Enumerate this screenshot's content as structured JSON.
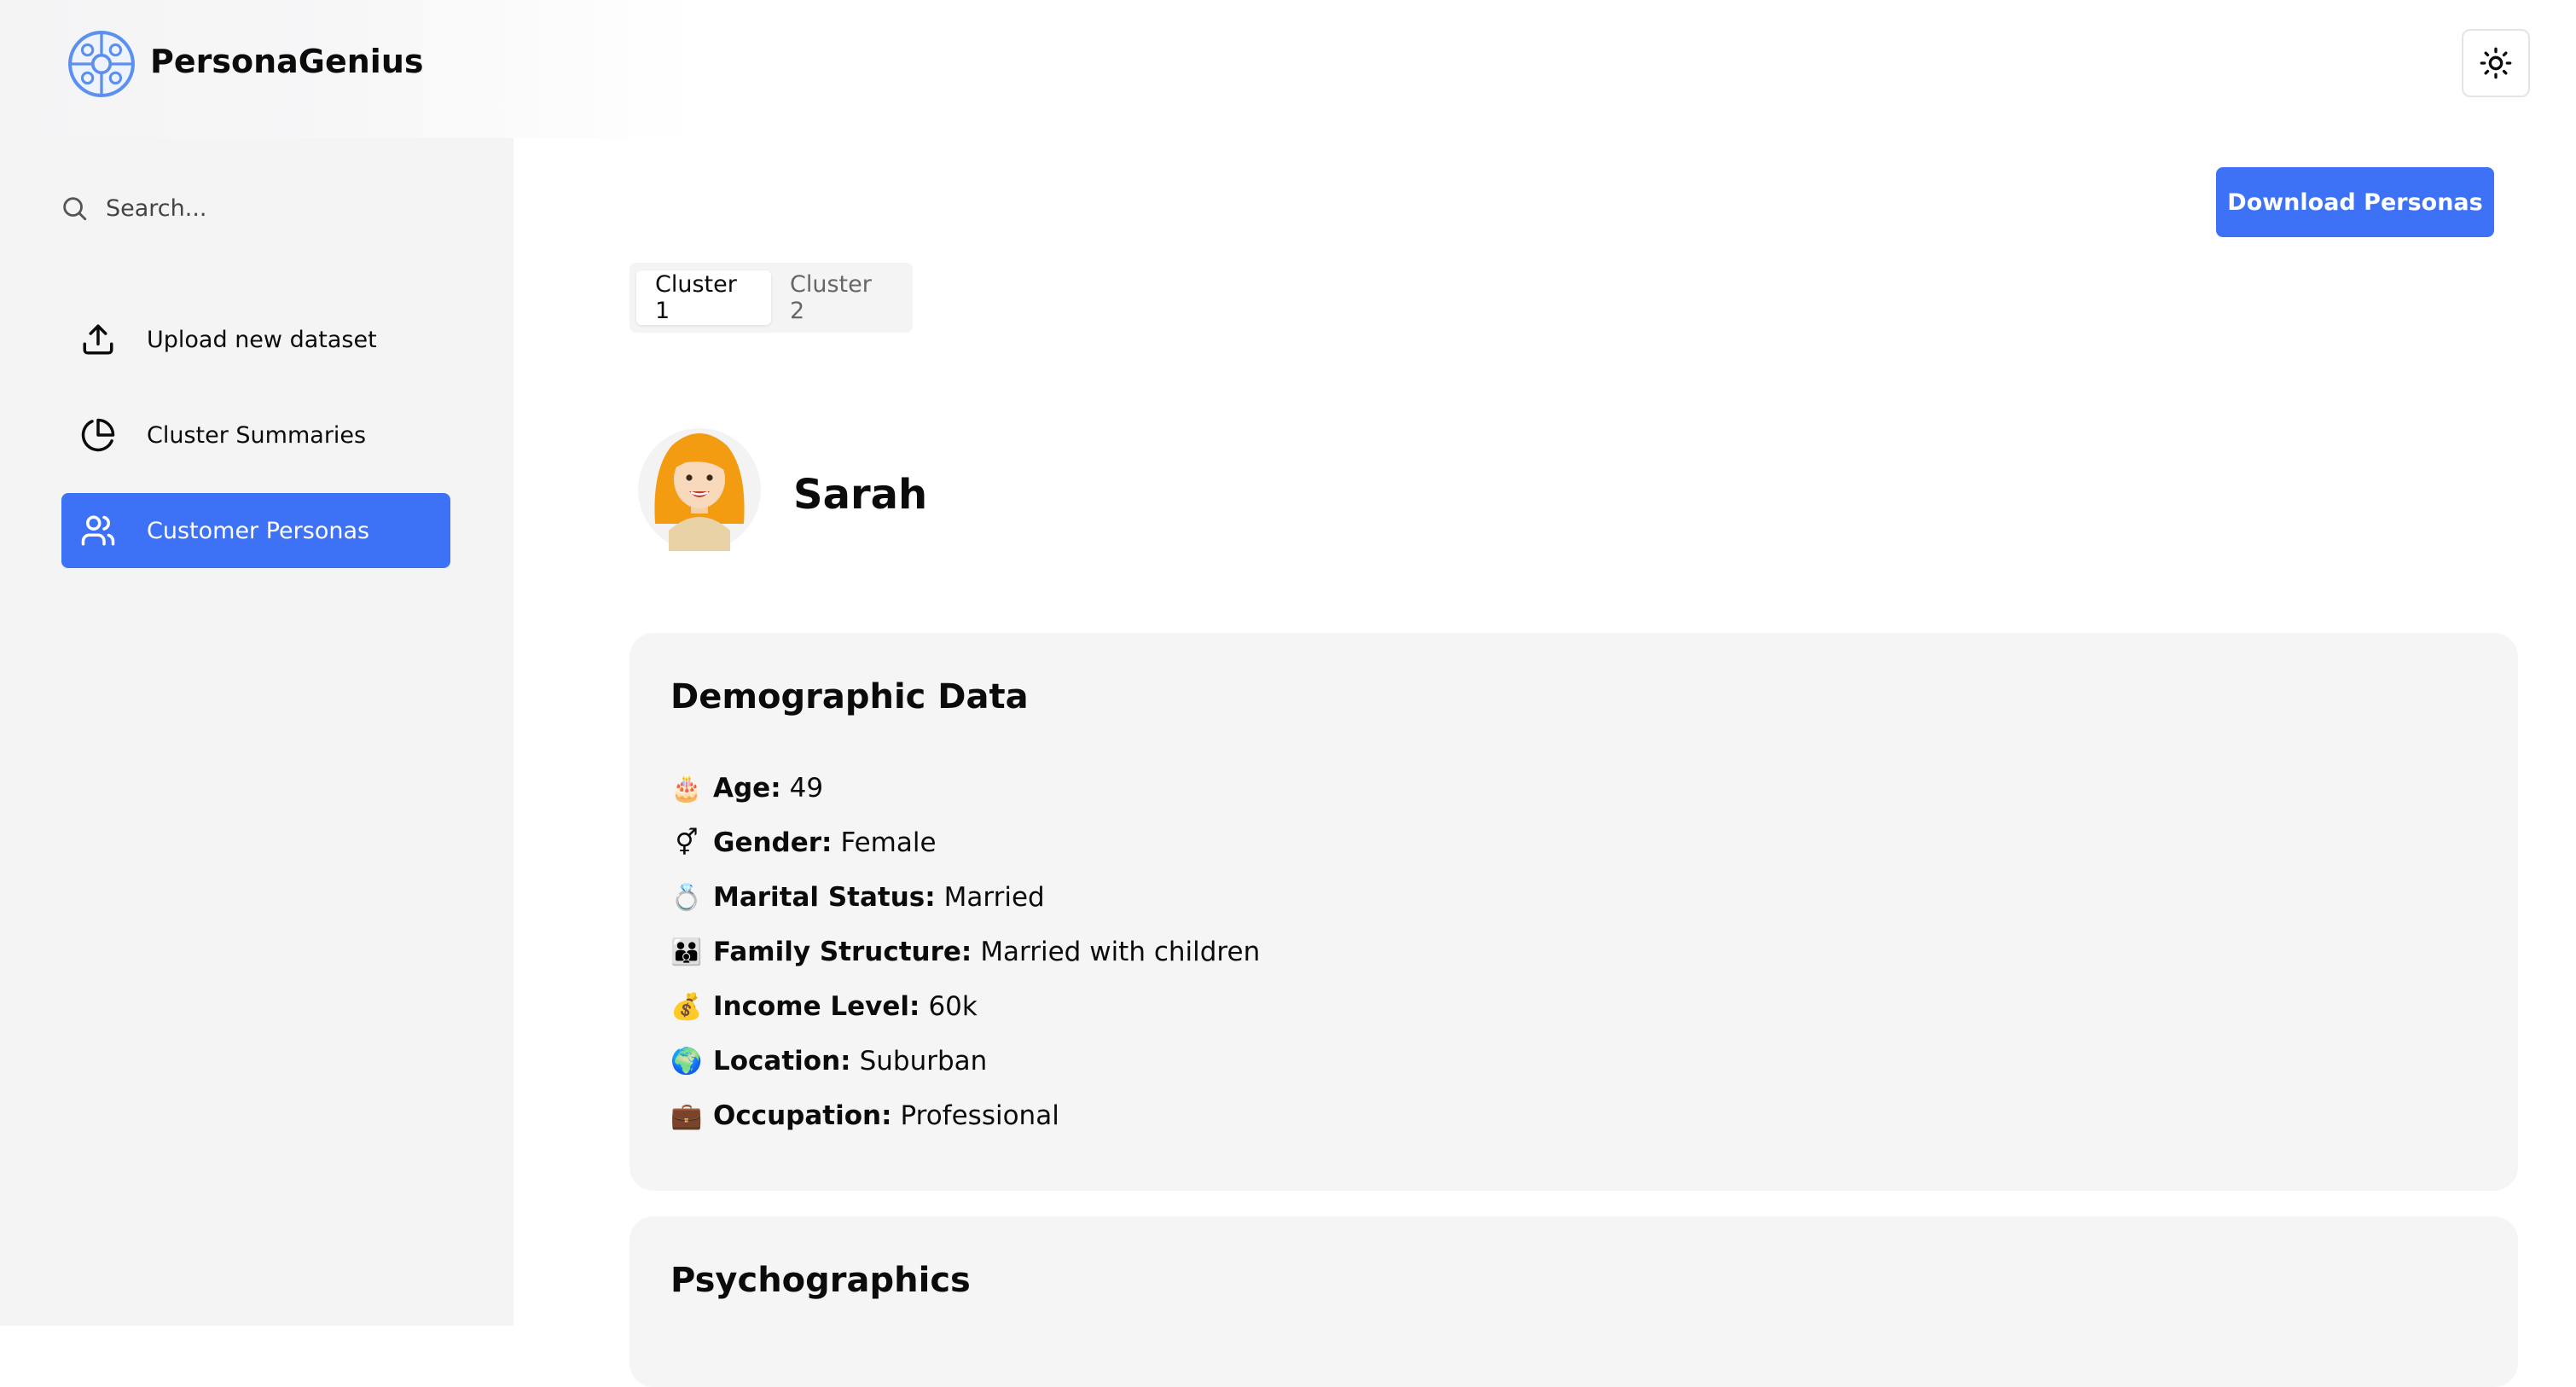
{
  "app": {
    "name": "PersonaGenius"
  },
  "search": {
    "placeholder": "Search..."
  },
  "nav": {
    "items": [
      {
        "label": "Upload new dataset",
        "icon": "upload-icon",
        "active": false
      },
      {
        "label": "Cluster Summaries",
        "icon": "pie-chart-icon",
        "active": false
      },
      {
        "label": "Customer Personas",
        "icon": "users-icon",
        "active": true
      }
    ]
  },
  "header": {
    "theme_toggle_icon": "sun-icon"
  },
  "main": {
    "download_label": "Download Personas",
    "tabs": [
      {
        "label": "Cluster 1",
        "active": true
      },
      {
        "label": "Cluster 2",
        "active": false
      }
    ],
    "persona": {
      "name": "Sarah",
      "demographics": {
        "title": "Demographic Data",
        "facts": [
          {
            "emoji": "🎂",
            "key": "Age:",
            "value": "49"
          },
          {
            "emoji": "⚥",
            "key": "Gender:",
            "value": "Female"
          },
          {
            "emoji": "💍",
            "key": "Marital Status:",
            "value": "Married"
          },
          {
            "emoji": "👪",
            "key": "Family Structure:",
            "value": "Married with children"
          },
          {
            "emoji": "💰",
            "key": "Income Level:",
            "value": "60k"
          },
          {
            "emoji": "🌍",
            "key": "Location:",
            "value": "Suburban"
          },
          {
            "emoji": "💼",
            "key": "Occupation:",
            "value": "Professional"
          }
        ]
      },
      "psychographics": {
        "title": "Psychographics"
      }
    }
  },
  "colors": {
    "accent": "#3e72f6",
    "sidebar_bg": "#f4f4f5",
    "card_bg": "#f5f5f5"
  }
}
